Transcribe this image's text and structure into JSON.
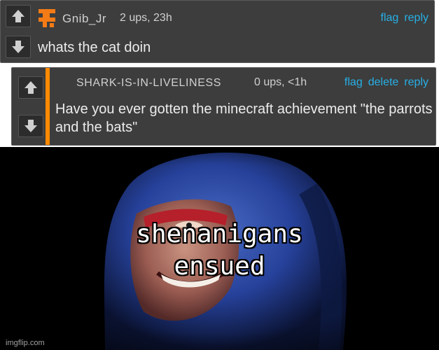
{
  "comments": [
    {
      "username": "Gnib_Jr",
      "meta": "2 ups, 23h",
      "actions": [
        "flag",
        "reply"
      ],
      "text": "whats the cat doin"
    },
    {
      "username": "SHARK-IS-IN-LIVELINESS",
      "meta": "0 ups, <1h",
      "actions": [
        "flag",
        "delete",
        "reply"
      ],
      "text": "Have you ever gotten the minecraft achievement \"the parrots and the bats\""
    }
  ],
  "meme": {
    "caption_line1": "shenanigans",
    "caption_line2": "ensued"
  },
  "watermark": "imgflip.com",
  "colors": {
    "link": "#27b0e6",
    "highlight_bar": "#ff8a00",
    "comment_bg": "#3d3d3d"
  },
  "icons": [
    "upvote-arrow-icon",
    "downvote-arrow-icon",
    "user-avatar-icon"
  ]
}
